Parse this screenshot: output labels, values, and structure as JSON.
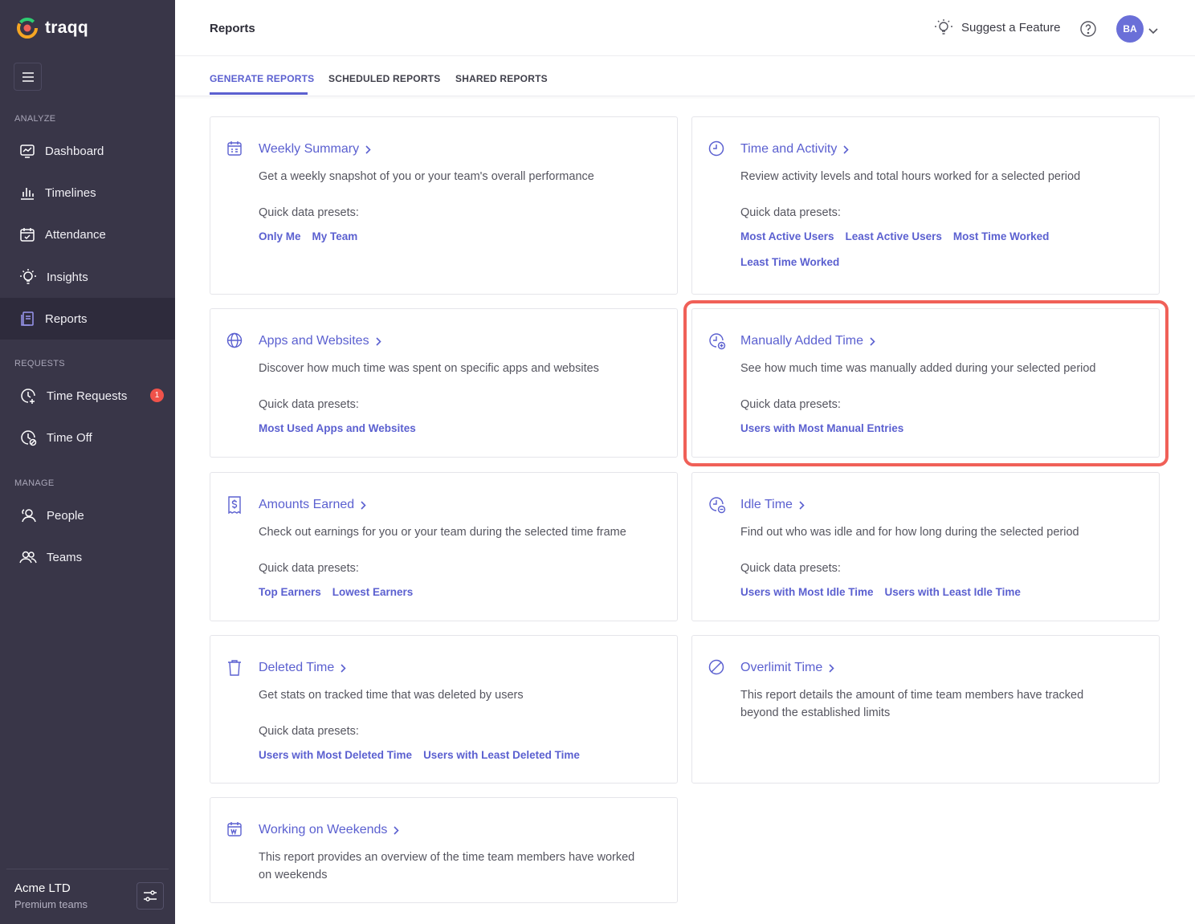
{
  "app": {
    "name": "traqq"
  },
  "sidebar": {
    "sections": {
      "analyze": "ANALYZE",
      "requests": "REQUESTS",
      "manage": "MANAGE"
    },
    "items": [
      {
        "label": "Dashboard"
      },
      {
        "label": "Timelines"
      },
      {
        "label": "Attendance"
      },
      {
        "label": "Insights"
      },
      {
        "label": "Reports"
      },
      {
        "label": "Time Requests",
        "badge": "1"
      },
      {
        "label": "Time Off"
      },
      {
        "label": "People"
      },
      {
        "label": "Teams"
      }
    ],
    "footer": {
      "org": "Acme LTD",
      "plan": "Premium teams"
    }
  },
  "header": {
    "title": "Reports",
    "suggest": "Suggest a Feature",
    "avatar": "BA"
  },
  "tabs": [
    {
      "label": "GENERATE REPORTS",
      "active": true
    },
    {
      "label": "SCHEDULED REPORTS"
    },
    {
      "label": "SHARED REPORTS"
    }
  ],
  "presets_label": "Quick data presets:",
  "cards": [
    {
      "title": "Weekly Summary",
      "desc": "Get a weekly snapshot of you or your team's overall performance",
      "presets": [
        "Only Me",
        "My Team"
      ]
    },
    {
      "title": "Time and Activity",
      "desc": "Review activity levels and total hours worked for a selected period",
      "presets": [
        "Most Active Users",
        "Least Active Users",
        "Most Time Worked",
        "Least Time Worked"
      ]
    },
    {
      "title": "Apps and Websites",
      "desc": "Discover how much time was spent on specific apps and websites",
      "presets": [
        "Most Used Apps and Websites"
      ]
    },
    {
      "title": "Manually Added Time",
      "desc": "See how much time was manually added during your selected period",
      "presets": [
        "Users with Most Manual Entries"
      ]
    },
    {
      "title": "Amounts Earned",
      "desc": "Check out earnings for you or your team during the selected time frame",
      "presets": [
        "Top Earners",
        "Lowest Earners"
      ]
    },
    {
      "title": "Idle Time",
      "desc": "Find out who was idle and for how long during the selected period",
      "presets": [
        "Users with Most Idle Time",
        "Users with Least Idle Time"
      ]
    },
    {
      "title": "Deleted Time",
      "desc": "Get stats on tracked time that was deleted by users",
      "presets": [
        "Users with Most Deleted Time",
        "Users with Least Deleted Time"
      ]
    },
    {
      "title": "Overlimit Time",
      "desc": "This report details the amount of time team members have tracked beyond the established limits",
      "presets": []
    },
    {
      "title": "Working on Weekends",
      "desc": "This report provides an overview of the time team members have worked on weekends",
      "presets": []
    }
  ],
  "colors": {
    "accent": "#5b60d0",
    "sidebar": "#393648",
    "highlight": "#f06058",
    "badge": "#f0524a"
  }
}
